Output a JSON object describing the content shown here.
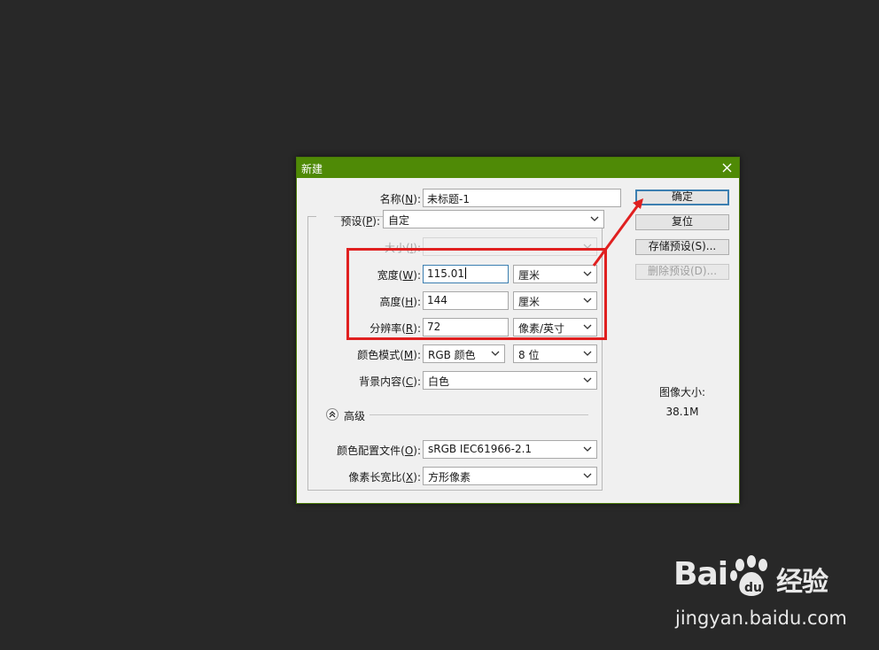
{
  "dialog": {
    "title": "新建",
    "close_icon": "close-icon",
    "name_label": "名称",
    "name_key": "N",
    "name_value": "未标题-1",
    "preset_label": "预设",
    "preset_key": "P",
    "preset_value": "自定",
    "size_label": "大小",
    "size_key": "I",
    "width_label": "宽度",
    "width_key": "W",
    "width_value": "115.01",
    "width_unit": "厘米",
    "height_label": "高度",
    "height_key": "H",
    "height_value": "144",
    "height_unit": "厘米",
    "resolution_label": "分辨率",
    "resolution_key": "R",
    "resolution_value": "72",
    "resolution_unit": "像素/英寸",
    "color_mode_label": "颜色模式",
    "color_mode_key": "M",
    "color_mode_value": "RGB 颜色",
    "bit_depth_value": "8 位",
    "background_label": "背景内容",
    "background_key": "C",
    "background_value": "白色",
    "advanced_label": "高级",
    "profile_label": "颜色配置文件",
    "profile_key": "O",
    "profile_value": "sRGB IEC61966-2.1",
    "pixel_aspect_label": "像素长宽比",
    "pixel_aspect_key": "X",
    "pixel_aspect_value": "方形像素",
    "ok_label": "确定",
    "reset_label": "复位",
    "save_preset_label": "存储预设(S)...",
    "delete_preset_label": "删除预设(D)...",
    "image_size_label": "图像大小:",
    "image_size_value": "38.1M"
  },
  "watermark": {
    "brand": "Bai",
    "brand_paw": "du",
    "brand_suffix": "经验",
    "url": "jingyan.baidu.com"
  },
  "colors": {
    "titlebar": "#4f8a06",
    "highlight": "#e02020",
    "background": "#282828"
  }
}
